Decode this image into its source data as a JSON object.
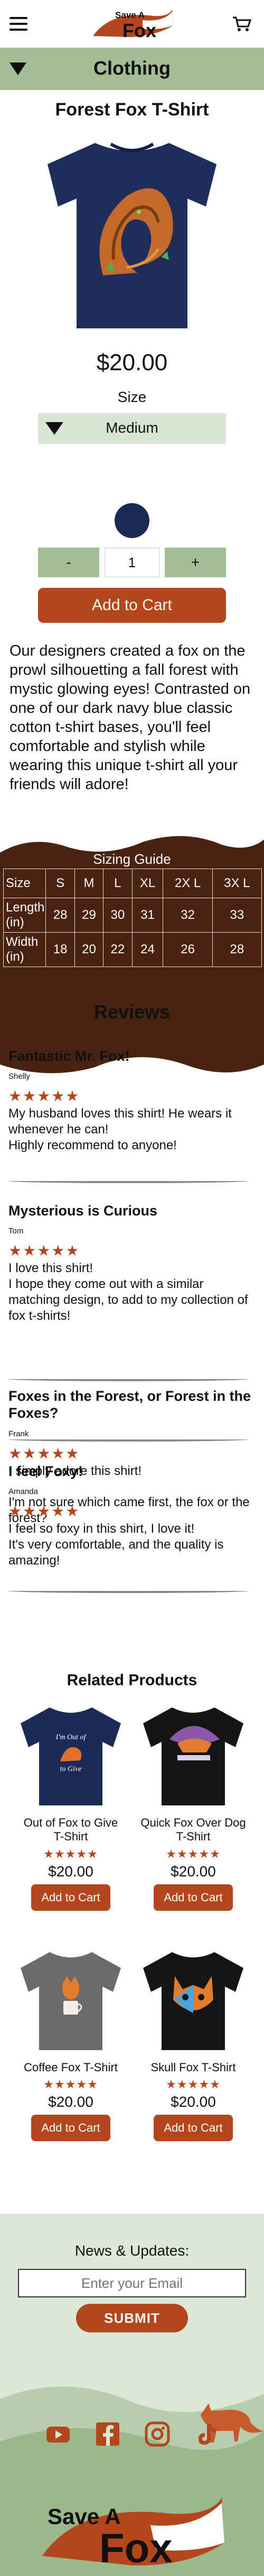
{
  "brand": {
    "logo_top": "Save A",
    "logo_main": "Fox"
  },
  "category": {
    "label": "Clothing"
  },
  "product": {
    "title": "Forest Fox T-Shirt",
    "price": "$20.00",
    "size_label": "Size",
    "size_value": "Medium",
    "qty_minus": "-",
    "qty_value": "1",
    "qty_plus": "+",
    "add_to_cart": "Add to Cart",
    "description": "Our designers created a fox on the prowl silhouetting a fall forest with mystic glowing eyes! Contrasted on one of our dark navy blue classic cotton t-shirt bases, you'll feel comfortable and stylish while wearing this unique t-shirt all your friends will adore!",
    "color_swatch": "#1c2a57"
  },
  "sizing_guide": {
    "title": "Sizing Guide",
    "headers": [
      "Size",
      "S",
      "M",
      "L",
      "XL",
      "2X L",
      "3X L"
    ],
    "rows": [
      [
        "Length (in)",
        "28",
        "29",
        "30",
        "31",
        "32",
        "33"
      ],
      [
        "Width (in)",
        "18",
        "20",
        "22",
        "24",
        "26",
        "28"
      ]
    ]
  },
  "reviews": {
    "heading": "Reviews",
    "items": [
      {
        "title": "Fantastic Mr. Fox!",
        "name": "Shelly",
        "stars": "★★★★★",
        "text": "My husband loves this shirt! He wears it whenever he can!\nHighly recommend to anyone!"
      },
      {
        "title": "Mysterious is Curious",
        "name": "Tom",
        "stars": "★★★★★",
        "text": "I love this shirt!\nI hope they come out with a similar matching design, to add to my collection of fox t-shirts!"
      },
      {
        "title": "Foxes in the Forest, or Forest in the Foxes?",
        "name": "Frank",
        "stars": "★★★★★",
        "text": "I simply adore this shirt!\n\nI'm not sure which came first, the fox or the forest?"
      },
      {
        "title": "I feel Foxy!",
        "name": "Amanda",
        "stars": "★★★★★",
        "text": "I feel so foxy in this shirt, I love it!\nIt's very comfortable, and the quality is amazing!"
      }
    ]
  },
  "related": {
    "heading": "Related Products",
    "items": [
      {
        "name": "Out of Fox to Give T-Shirt",
        "stars": "★★★★★",
        "price": "$20.00",
        "button": "Add to Cart",
        "shirt_color": "#1c2a57",
        "print_text": "I'm Out of Fox to Give"
      },
      {
        "name": "Quick Fox Over Dog T-Shirt",
        "stars": "★★★★★",
        "price": "$20.00",
        "button": "Add to Cart",
        "shirt_color": "#151515"
      },
      {
        "name": "Coffee Fox T-Shirt",
        "stars": "★★★★★",
        "price": "$20.00",
        "button": "Add to Cart",
        "shirt_color": "#6b6b6b"
      },
      {
        "name": "Skull Fox T-Shirt",
        "stars": "★★★★★",
        "price": "$20.00",
        "button": "Add to Cart",
        "shirt_color": "#151515"
      }
    ]
  },
  "footer": {
    "news_label": "News & Updates:",
    "email_placeholder": "Enter your Email",
    "submit": "SUBMIT",
    "social": [
      "youtube-icon",
      "facebook-icon",
      "instagram-icon",
      "tiktok-icon"
    ]
  },
  "colors": {
    "accent": "#b5461c",
    "green": "#a3bd97",
    "brown": "#4a2212"
  }
}
